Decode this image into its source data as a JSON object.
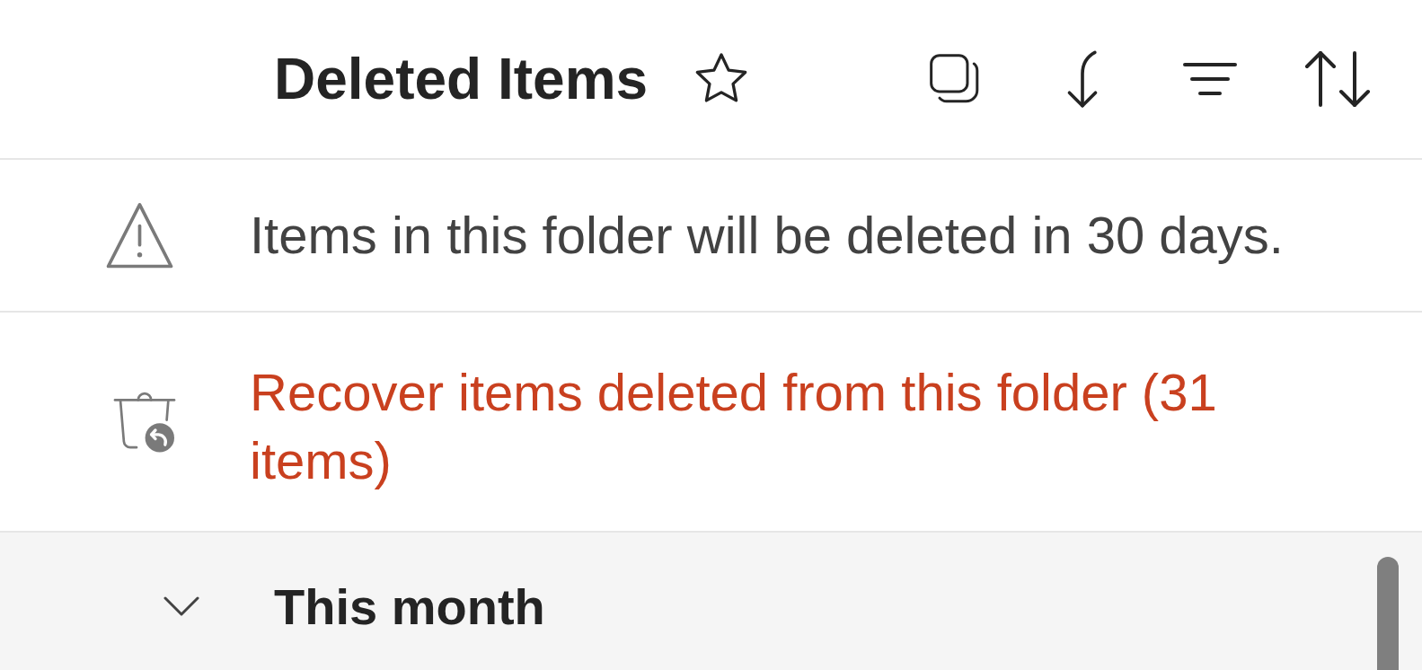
{
  "header": {
    "title": "Deleted Items",
    "starred": false
  },
  "notice": {
    "text": "Items in this folder will be deleted in 30 days."
  },
  "recover_link": {
    "text": "Recover items deleted from this folder (31 items)"
  },
  "groups": [
    {
      "label": "This month",
      "expanded": true
    }
  ]
}
